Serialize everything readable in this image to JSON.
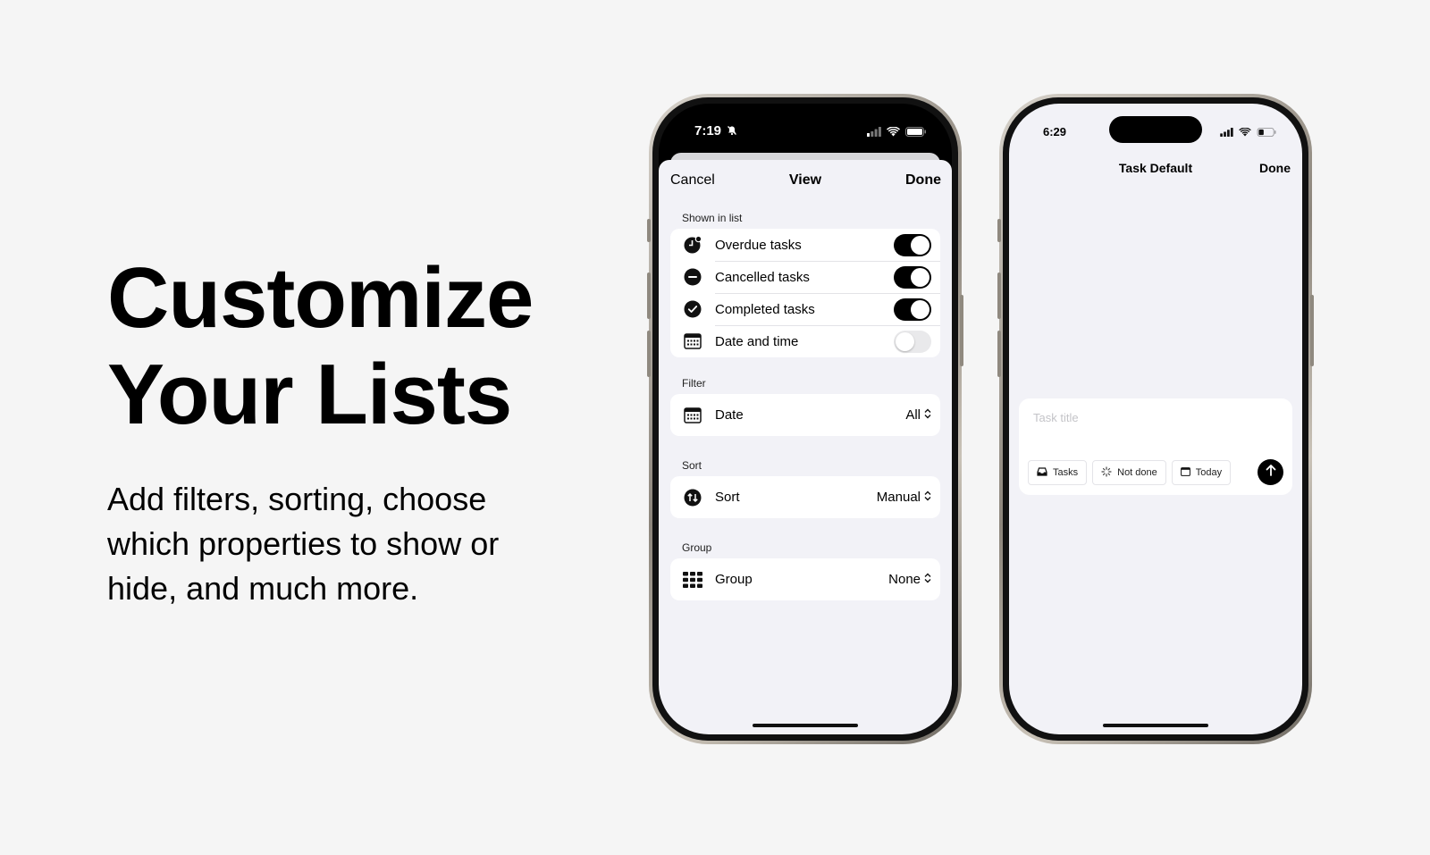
{
  "hero": {
    "title_line1": "Customize",
    "title_line2": "Your Lists",
    "subtitle": "Add filters, sorting, choose which properties to show or hide, and much more."
  },
  "phone1": {
    "time": "7:19",
    "nav": {
      "cancel": "Cancel",
      "title": "View",
      "done": "Done"
    },
    "shown_in_list": {
      "label": "Shown in list",
      "items": [
        {
          "label": "Overdue tasks",
          "icon": "overdue-clock-icon",
          "enabled": true
        },
        {
          "label": "Cancelled tasks",
          "icon": "minus-circle-icon",
          "enabled": true
        },
        {
          "label": "Completed tasks",
          "icon": "check-circle-icon",
          "enabled": true
        },
        {
          "label": "Date and time",
          "icon": "calendar-icon",
          "enabled": false
        }
      ]
    },
    "filter": {
      "label": "Filter",
      "row_label": "Date",
      "value": "All"
    },
    "sort": {
      "label": "Sort",
      "row_label": "Sort",
      "value": "Manual"
    },
    "group": {
      "label": "Group",
      "row_label": "Group",
      "value": "None"
    }
  },
  "phone2": {
    "time": "6:29",
    "nav": {
      "title": "Task Default",
      "done": "Done"
    },
    "composer": {
      "placeholder": "Task title",
      "chips": [
        {
          "label": "Tasks",
          "icon": "inbox-icon"
        },
        {
          "label": "Not done",
          "icon": "loading-spinner-icon"
        },
        {
          "label": "Today",
          "icon": "calendar-icon"
        }
      ]
    }
  },
  "colors": {
    "accent": "#000000",
    "background": "#f5f5f5",
    "sheet": "#f2f2f7"
  }
}
